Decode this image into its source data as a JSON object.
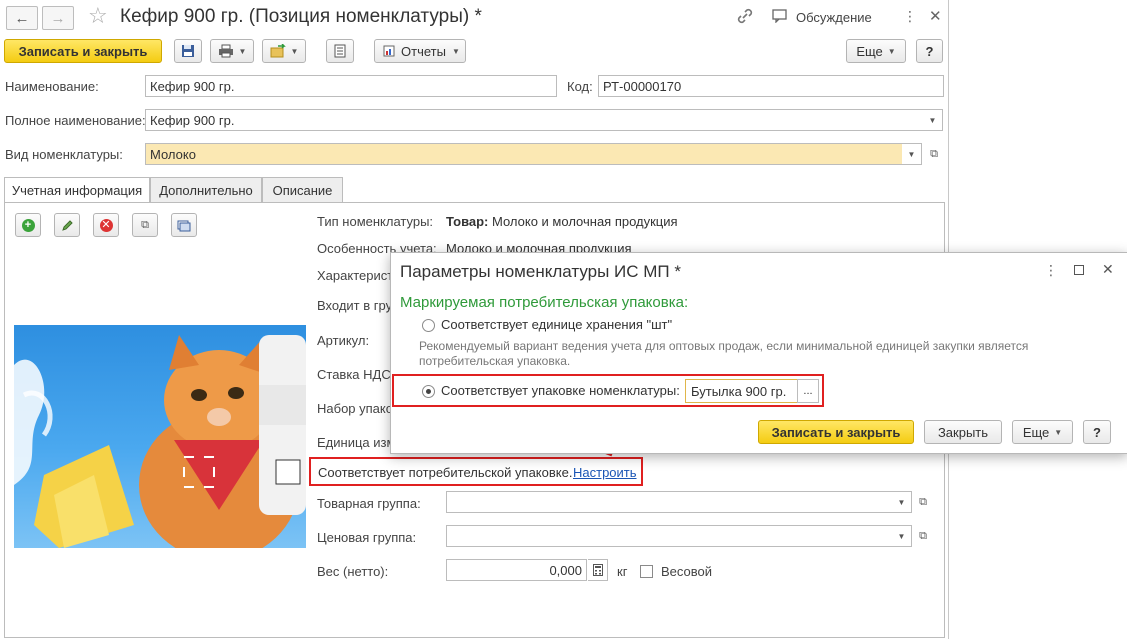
{
  "window": {
    "title": "Кефир 900 гр. (Позиция номенклатуры) *",
    "discussion_label": "Обсуждение"
  },
  "toolbar": {
    "save_close_label": "Записать и закрыть",
    "reports_label": "Отчеты",
    "more_label": "Еще",
    "help_label": "?"
  },
  "form": {
    "name_label": "Наименование:",
    "name_value": "Кефир 900 гр.",
    "code_label": "Код:",
    "code_value": "РТ-00000170",
    "full_name_label": "Полное наименование:",
    "full_name_value": "Кефир 900 гр.",
    "kind_label": "Вид номенклатуры:",
    "kind_value": "Молоко"
  },
  "tabs": [
    {
      "label": "Учетная информация"
    },
    {
      "label": "Дополнительно"
    },
    {
      "label": "Описание"
    }
  ],
  "details": {
    "type_label": "Тип номенклатуры:",
    "type_value_bold": "Товар:",
    "type_value_rest": " Молоко и молочная продукция",
    "feature_label": "Особенность учета:",
    "feature_value": "Молоко и молочная продукция",
    "characteristics_label": "Характерист",
    "group_in_label": "Входит в гру",
    "article_label": "Артикул:",
    "vat_label": "Ставка НДС",
    "package_set_label": "Набор упако",
    "unit_label": "Единица изм",
    "consumer_pack_text": "Соответствует потребительской упаковке.",
    "consumer_pack_link": "Настроить",
    "product_group_label": "Товарная группа:",
    "price_group_label": "Ценовая группа:",
    "weight_label": "Вес (нетто):",
    "weight_value": "0,000",
    "weight_unit": "кг",
    "weight_checkbox_label": "Весовой"
  },
  "dialog": {
    "title": "Параметры номенклатуры ИС МП *",
    "section_title": "Маркируемая потребительская упаковка:",
    "option1_label": "Соответствует единице хранения \"шт\"",
    "hint_line1": "Рекомендуемый вариант ведения учета для оптовых продаж, если минимальной единицей закупки является",
    "hint_line2": "потребительская упаковка.",
    "option2_label": "Соответствует упаковке номенклатуры:",
    "option2_value": "Бутылка 900 гр.",
    "ellipsis": "...",
    "save_close_label": "Записать и закрыть",
    "close_label": "Закрыть",
    "more_label": "Еще",
    "help_label": "?",
    "selected_option": 2
  },
  "colors": {
    "accent_yellow": "#f4cc12",
    "section_green": "#2f9a3a",
    "highlight_red": "#e02020",
    "link_blue": "#1a55b5"
  }
}
